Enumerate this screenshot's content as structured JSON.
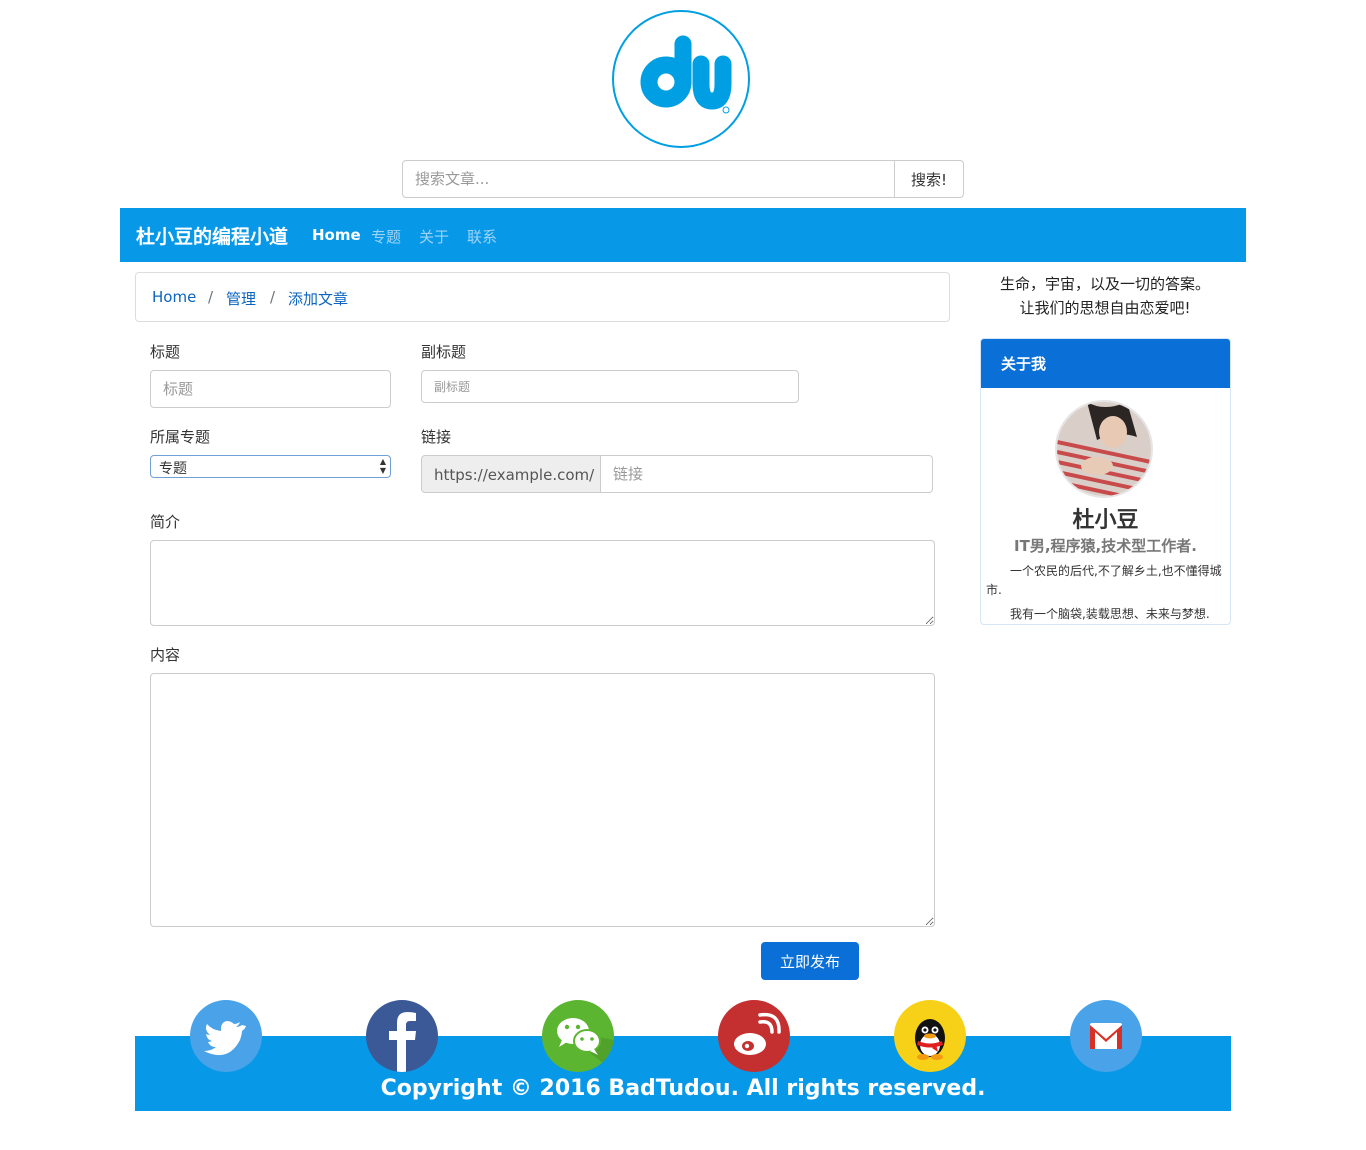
{
  "search": {
    "placeholder": "搜索文章...",
    "button": "搜索!"
  },
  "navbar": {
    "brand": "杜小豆的编程小道",
    "links": [
      "Home",
      "专题",
      "关于",
      "联系"
    ]
  },
  "breadcrumb": [
    "Home",
    "管理",
    "添加文章"
  ],
  "form": {
    "title_label": "标题",
    "title_placeholder": "标题",
    "subtitle_label": "副标题",
    "subtitle_placeholder": "副标题",
    "topic_label": "所属专题",
    "topic_selected": "专题",
    "link_label": "链接",
    "link_prefix": "https://example.com/",
    "link_placeholder": "链接",
    "summary_label": "简介",
    "content_label": "内容",
    "publish_button": "立即发布"
  },
  "sidebar": {
    "motto_line1": "生命，宇宙，以及一切的答案。",
    "motto_line2": "让我们的思想自由恋爱吧!",
    "about_title": "关于我",
    "name": "杜小豆",
    "role": "IT男,程序猿,技术型工作者.",
    "text1": "一个农民的后代,不了解乡土,也不懂得城市.",
    "text2": "我有一个脑袋,装载思想、未来与梦想."
  },
  "footer": {
    "copyright": "Copyright © 2016 BadTudou. All rights reserved.",
    "social_icons": [
      "twitter-icon",
      "facebook-icon",
      "wechat-icon",
      "weibo-icon",
      "qq-icon",
      "gmail-icon"
    ]
  },
  "colors": {
    "nav": "#0898e8",
    "primary": "#0a6fd6",
    "logo": "#009fe3"
  }
}
